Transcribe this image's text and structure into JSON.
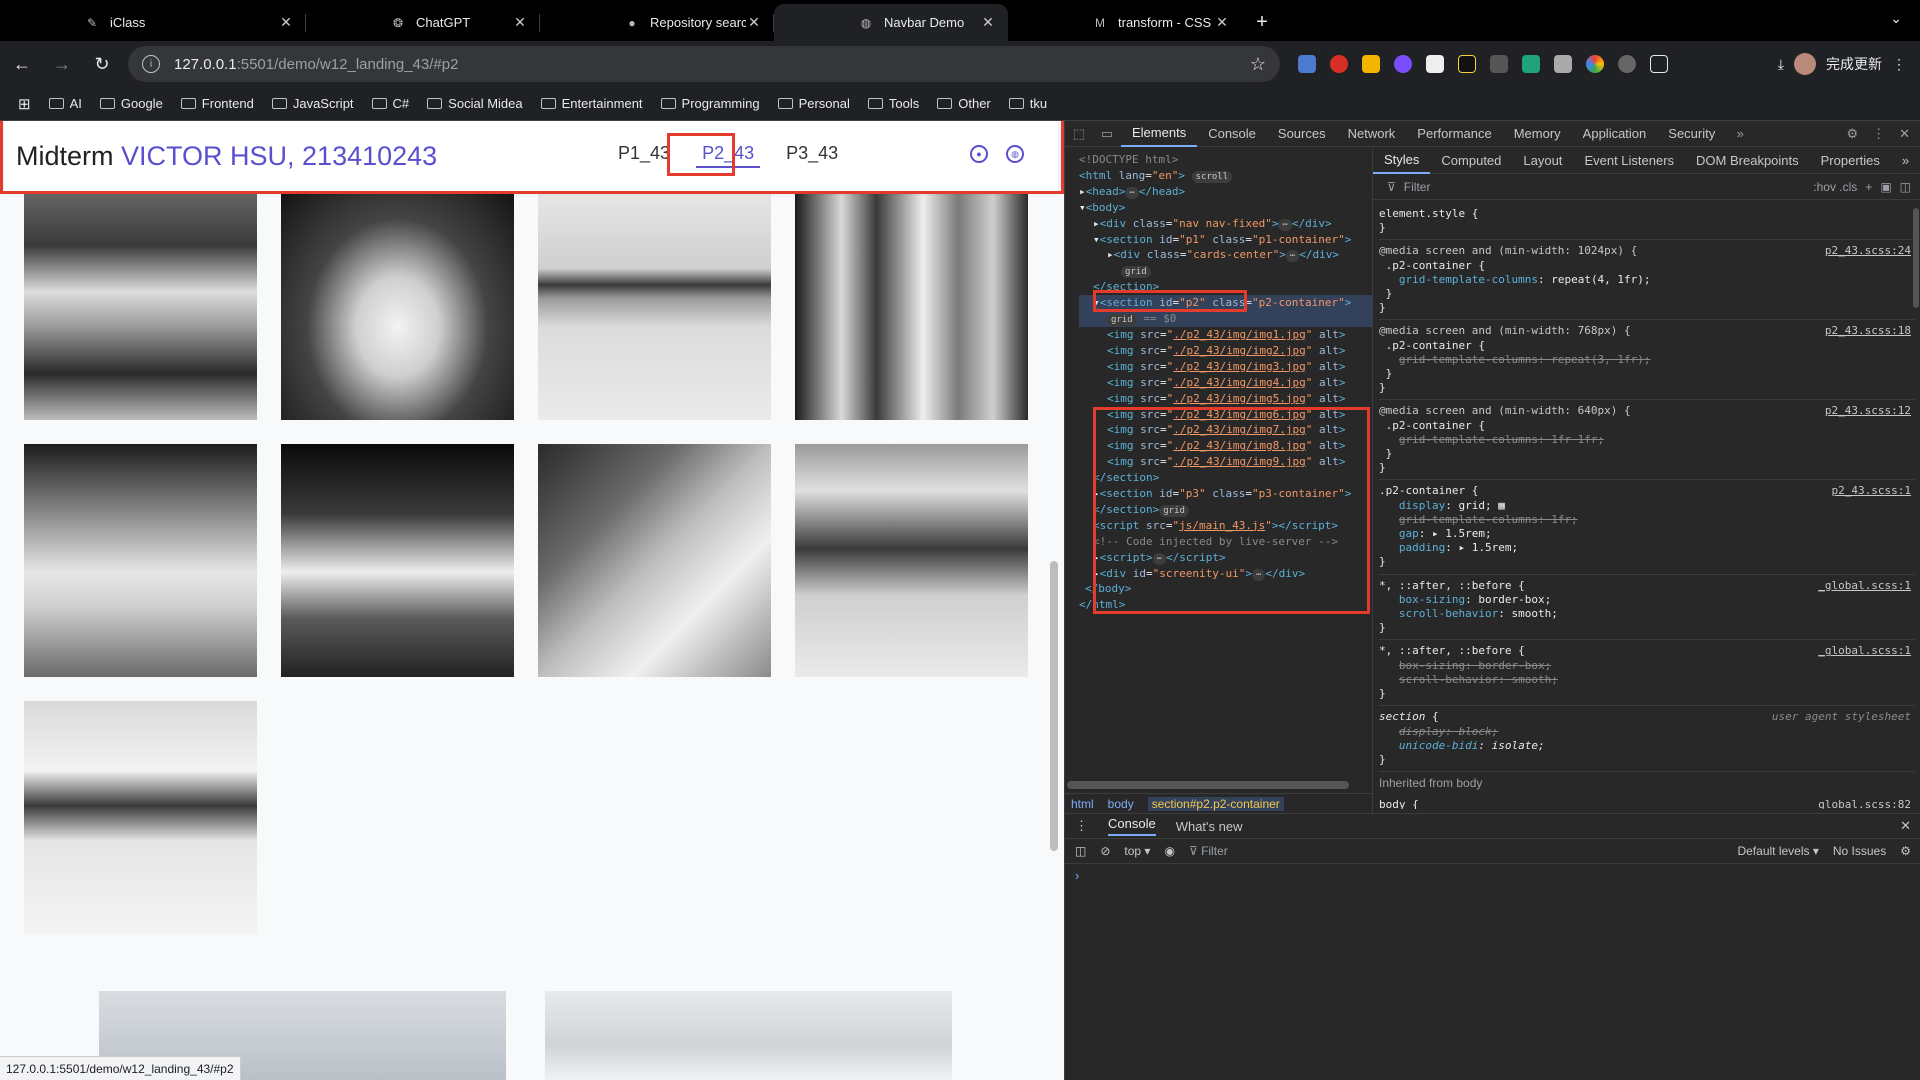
{
  "tabs": [
    {
      "title": "iClass",
      "icon": "iclass-icon",
      "active": false
    },
    {
      "title": "ChatGPT",
      "icon": "chatgpt-icon",
      "active": false
    },
    {
      "title": "Repository search results",
      "icon": "github-icon",
      "active": false
    },
    {
      "title": "Navbar Demo",
      "icon": "globe-icon",
      "active": true
    },
    {
      "title": "transform - CSS | MDN",
      "icon": "mdn-icon",
      "active": false
    }
  ],
  "address": {
    "host": "127.0.0.1",
    "path": ":5501/demo/w12_landing_43/#p2"
  },
  "update_label": "完成更新",
  "bookmarks": [
    "AI",
    "Google",
    "Frontend",
    "JavaScript",
    "C#",
    "Social Midea",
    "Entertainment",
    "Programming",
    "Personal",
    "Tools",
    "Other",
    "tku"
  ],
  "page": {
    "brand_prefix": "Midterm ",
    "brand_name": "VICTOR HSU, 213410243",
    "nav_links": [
      "P1_43",
      "P2_43",
      "P3_43"
    ],
    "active_link": "P2_43",
    "photos": [
      "img1",
      "img2",
      "img3",
      "img4",
      "img5",
      "img6",
      "img7",
      "img8",
      "img9"
    ],
    "status_url": "127.0.0.1:5501/demo/w12_landing_43/#p2"
  },
  "devtools": {
    "tabs": [
      "Elements",
      "Console",
      "Sources",
      "Network",
      "Performance",
      "Memory",
      "Application",
      "Security"
    ],
    "active_tab": "Elements",
    "styles_tabs": [
      "Styles",
      "Computed",
      "Layout",
      "Event Listeners",
      "DOM Breakpoints",
      "Properties"
    ],
    "filter_placeholder": "Filter",
    "filter_tools": ":hov .cls",
    "breadcrumb": [
      "html",
      "body",
      "section#p2.p2-container"
    ],
    "drawer_tabs": [
      "Console",
      "What's new"
    ],
    "console_context": "top",
    "console_filter": "Filter",
    "console_levels": "Default levels",
    "console_issues": "No Issues",
    "inherited_label": "Inherited from body",
    "dom": {
      "doctype": "<!DOCTYPE html>",
      "img_srcs": [
        "./p2_43/img/img1.jpg",
        "./p2_43/img/img2.jpg",
        "./p2_43/img/img3.jpg",
        "./p2_43/img/img4.jpg",
        "./p2_43/img/img5.jpg",
        "./p2_43/img/img6.jpg",
        "./p2_43/img/img7.jpg",
        "./p2_43/img/img8.jpg",
        "./p2_43/img/img9.jpg"
      ],
      "script_src": "js/main_43.js",
      "comment": "<!-- Code injected by live-server -->"
    }
  },
  "colors": {
    "accent": "#5a4fcf",
    "highlight": "#e53b2c"
  }
}
